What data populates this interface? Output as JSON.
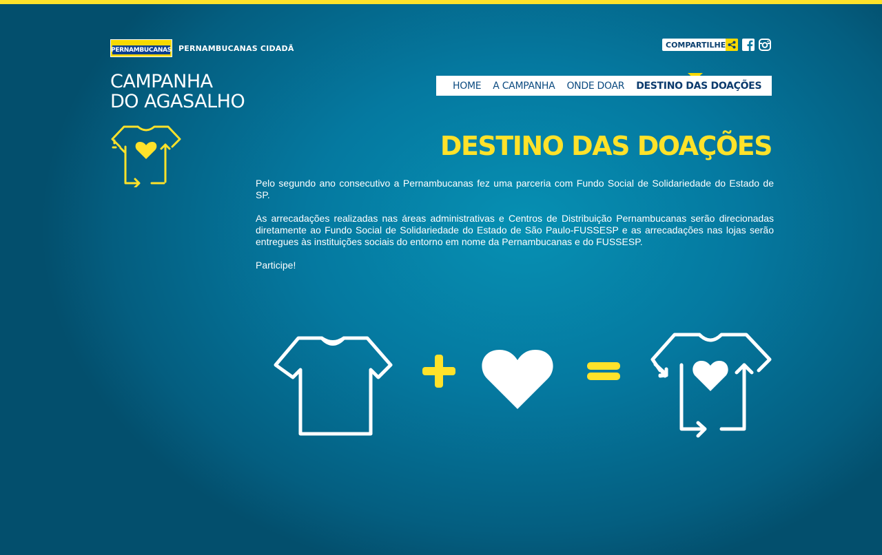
{
  "brand": {
    "logo_text": "PERNAMBUCANAS",
    "subtitle": "PERNAMBUCANAS CIDADÃ"
  },
  "campaign": {
    "title_line1": "CAMPANHA",
    "title_line2": "DO AGASALHO"
  },
  "share": {
    "label": "COMPARTILHE",
    "icons": [
      "share-icon",
      "facebook-icon",
      "instagram-icon"
    ]
  },
  "nav": {
    "items": [
      {
        "label": "HOME"
      },
      {
        "label": "A CAMPANHA"
      },
      {
        "label": "ONDE DOAR"
      },
      {
        "label": "DESTINO DAS DOAÇÕES",
        "active": true
      }
    ]
  },
  "page": {
    "heading": "DESTINO DAS DOAÇÕES",
    "paragraphs": [
      "Pelo segundo ano consecutivo a Pernambucanas fez uma parceria com Fundo Social de Solidariedade do Estado de SP.",
      "As arrecadações realizadas nas áreas administrativas e Centros de Distribuição Pernambucanas serão direcionadas diretamente ao Fundo Social de Solidariedade do Estado de São Paulo-FUSSESP e as arrecadações nas lojas serão entregues às instituições sociais do entorno em nome da Pernambucanas e do FUSSESP.",
      "Participe!"
    ]
  },
  "colors": {
    "accent_yellow": "#ffe22a",
    "nav_text": "#0b4a80",
    "background": "#0579a0"
  },
  "equation_icons": [
    "tshirt-icon",
    "plus-icon",
    "heart-icon",
    "equals-icon",
    "recycle-tshirt-heart-icon"
  ]
}
